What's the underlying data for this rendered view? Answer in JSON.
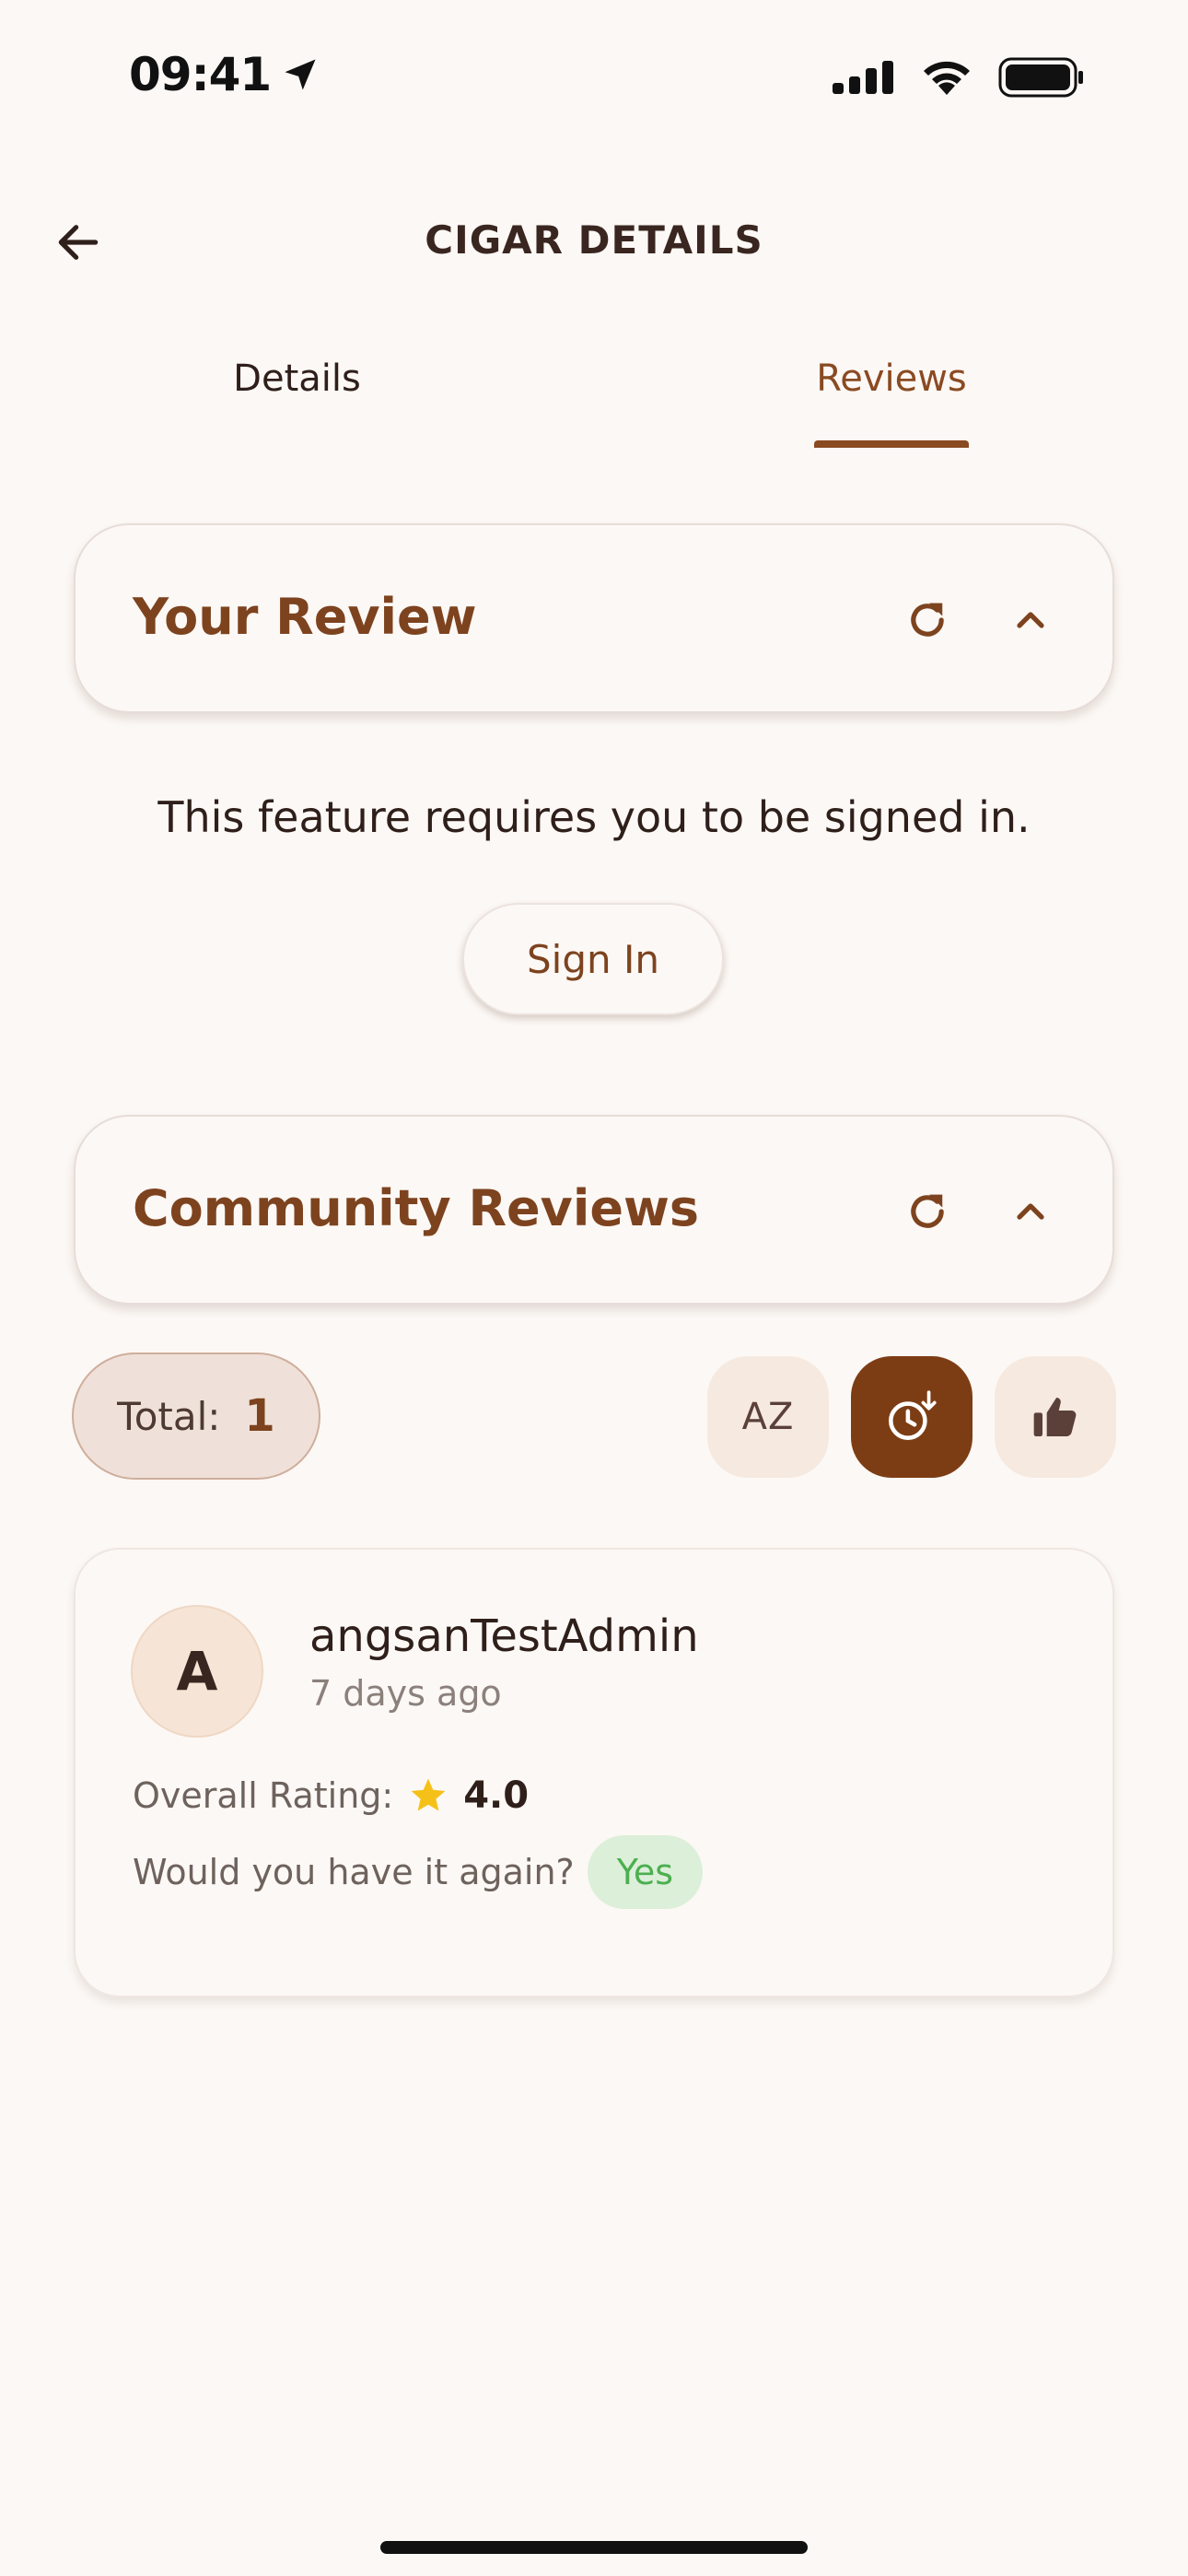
{
  "status_bar": {
    "time": "09:41",
    "location_icon": "location-arrow-icon",
    "signal_icon": "cellular-signal-icon",
    "wifi_icon": "wifi-icon",
    "battery_icon": "battery-icon"
  },
  "header": {
    "title": "CIGAR DETAILS",
    "back_icon": "arrow-left-icon"
  },
  "tabs": [
    {
      "label": "Details",
      "active": false
    },
    {
      "label": "Reviews",
      "active": true
    }
  ],
  "your_review": {
    "title": "Your Review",
    "refresh_icon": "refresh-icon",
    "collapse_icon": "chevron-up-icon",
    "signin_message": "This feature requires you to be signed in.",
    "signin_button": "Sign In"
  },
  "community_reviews": {
    "title": "Community Reviews",
    "refresh_icon": "refresh-icon",
    "collapse_icon": "chevron-up-icon",
    "total_label": "Total:",
    "total_count": "1",
    "sort_options": [
      {
        "label": "AZ",
        "icon": "",
        "active": false
      },
      {
        "label": "",
        "icon": "clock-sort-icon",
        "active": true
      },
      {
        "label": "",
        "icon": "thumbs-up-icon",
        "active": false
      }
    ],
    "reviews": [
      {
        "avatar_letter": "A",
        "username": "angsanTestAdmin",
        "time_ago": "7 days ago",
        "rating_label": "Overall Rating:",
        "rating_value": "4.0",
        "again_label": "Would you have it again?",
        "again_value": "Yes"
      }
    ]
  },
  "colors": {
    "background": "#fcf8f5",
    "accent": "#7d431f",
    "active_sort": "#7d3d14",
    "star": "#f5c118",
    "yes_badge_bg": "#dcefd9",
    "yes_badge_text": "#4caf50"
  }
}
